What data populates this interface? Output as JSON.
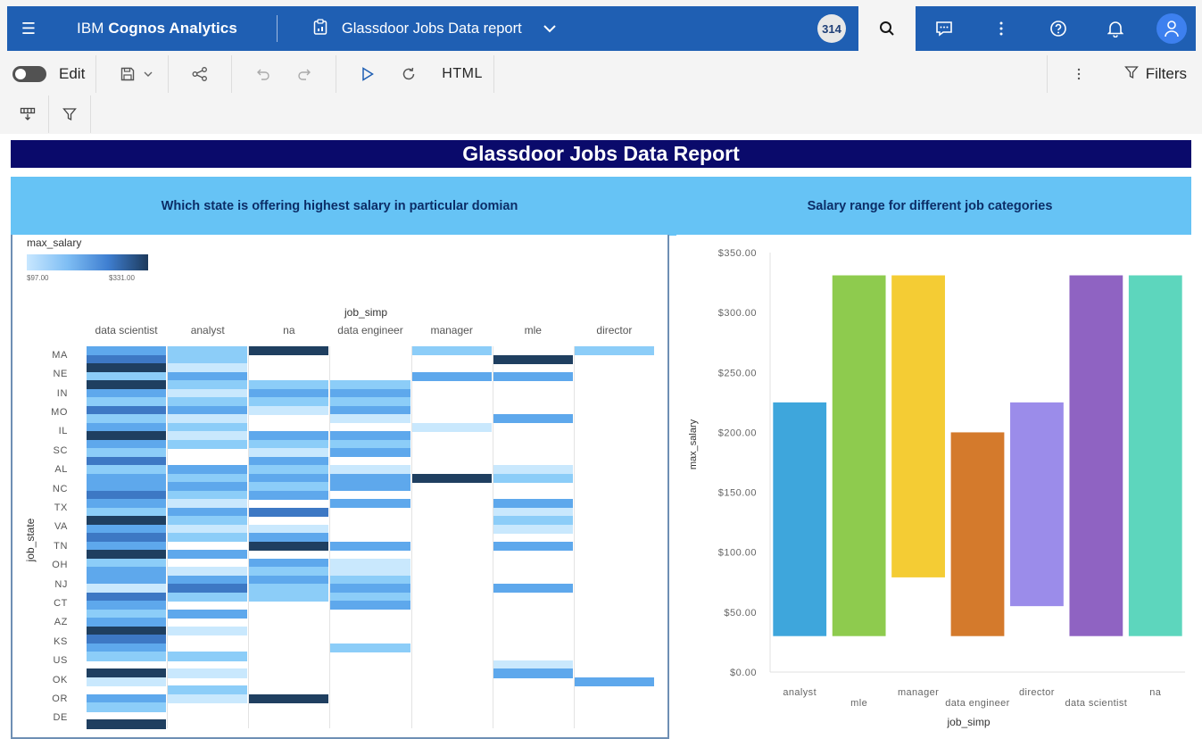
{
  "appbar": {
    "brand_prefix": "IBM",
    "brand_name": "Cognos Analytics",
    "report_title": "Glassdoor Jobs Data report",
    "badge": "314"
  },
  "toolbar": {
    "edit_label": "Edit",
    "html_label": "HTML",
    "filters_label": "Filters"
  },
  "report": {
    "header": "Glassdoor Jobs Data Report",
    "left_panel_title": "Which state is offering highest salary in particular domian",
    "right_panel_title": "Salary range for different job categories"
  },
  "heatmap": {
    "legend_title": "max_salary",
    "legend_min": "$97.00",
    "legend_max": "$331.00",
    "x_title": "job_simp",
    "y_title": "job_state",
    "columns": [
      "data scientist",
      "analyst",
      "na",
      "data engineer",
      "manager",
      "mle",
      "director"
    ],
    "rows": [
      "MA",
      "NE",
      "IN",
      "MO",
      "IL",
      "SC",
      "AL",
      "NC",
      "TX",
      "VA",
      "TN",
      "OH",
      "NJ",
      "CT",
      "AZ",
      "KS",
      "US",
      "OK",
      "OR",
      "DE"
    ],
    "colors": {
      "1": "#c9e8fd",
      "2": "#8ccdf8",
      "3": "#5ea8ec",
      "4": "#3d78c4",
      "5": "#1f3f60"
    },
    "cells": [
      [
        0,
        3,
        0
      ],
      [
        0,
        4,
        1
      ],
      [
        0,
        5,
        2
      ],
      [
        0,
        2,
        3
      ],
      [
        0,
        5,
        4
      ],
      [
        0,
        3,
        5
      ],
      [
        0,
        2,
        6
      ],
      [
        0,
        4,
        7
      ],
      [
        0,
        2,
        8
      ],
      [
        0,
        3,
        9
      ],
      [
        0,
        5,
        10
      ],
      [
        0,
        3,
        11
      ],
      [
        0,
        2,
        12
      ],
      [
        0,
        4,
        13
      ],
      [
        0,
        2,
        14
      ],
      [
        0,
        3,
        15
      ],
      [
        0,
        3,
        16
      ],
      [
        0,
        4,
        17
      ],
      [
        0,
        3,
        18
      ],
      [
        0,
        2,
        19
      ],
      [
        0,
        5,
        20
      ],
      [
        0,
        3,
        21
      ],
      [
        0,
        4,
        22
      ],
      [
        0,
        3,
        23
      ],
      [
        0,
        5,
        24
      ],
      [
        0,
        2,
        25
      ],
      [
        0,
        3,
        26
      ],
      [
        0,
        3,
        27
      ],
      [
        0,
        1,
        28
      ],
      [
        0,
        4,
        29
      ],
      [
        0,
        3,
        30
      ],
      [
        0,
        2,
        31
      ],
      [
        0,
        3,
        32
      ],
      [
        0,
        5,
        33
      ],
      [
        0,
        4,
        34
      ],
      [
        0,
        3,
        35
      ],
      [
        0,
        2,
        36
      ],
      [
        0,
        5,
        38
      ],
      [
        0,
        1,
        39
      ],
      [
        0,
        3,
        41
      ],
      [
        0,
        2,
        42
      ],
      [
        0,
        5,
        44
      ],
      [
        1,
        2,
        0
      ],
      [
        1,
        2,
        1
      ],
      [
        1,
        1,
        2
      ],
      [
        1,
        3,
        3
      ],
      [
        1,
        2,
        4
      ],
      [
        1,
        1,
        5
      ],
      [
        1,
        2,
        6
      ],
      [
        1,
        3,
        7
      ],
      [
        1,
        1,
        8
      ],
      [
        1,
        2,
        9
      ],
      [
        1,
        1,
        10
      ],
      [
        1,
        2,
        11
      ],
      [
        1,
        3,
        14
      ],
      [
        1,
        2,
        15
      ],
      [
        1,
        3,
        16
      ],
      [
        1,
        2,
        17
      ],
      [
        1,
        1,
        18
      ],
      [
        1,
        3,
        19
      ],
      [
        1,
        2,
        20
      ],
      [
        1,
        1,
        21
      ],
      [
        1,
        2,
        22
      ],
      [
        1,
        3,
        24
      ],
      [
        1,
        1,
        26
      ],
      [
        1,
        3,
        27
      ],
      [
        1,
        4,
        28
      ],
      [
        1,
        2,
        29
      ],
      [
        1,
        3,
        31
      ],
      [
        1,
        1,
        33
      ],
      [
        1,
        2,
        36
      ],
      [
        1,
        1,
        38
      ],
      [
        1,
        2,
        40
      ],
      [
        1,
        1,
        41
      ],
      [
        2,
        5,
        0
      ],
      [
        2,
        2,
        4
      ],
      [
        2,
        3,
        5
      ],
      [
        2,
        2,
        6
      ],
      [
        2,
        1,
        7
      ],
      [
        2,
        3,
        10
      ],
      [
        2,
        2,
        11
      ],
      [
        2,
        1,
        12
      ],
      [
        2,
        3,
        13
      ],
      [
        2,
        2,
        14
      ],
      [
        2,
        3,
        15
      ],
      [
        2,
        2,
        16
      ],
      [
        2,
        3,
        17
      ],
      [
        2,
        4,
        19
      ],
      [
        2,
        1,
        21
      ],
      [
        2,
        3,
        22
      ],
      [
        2,
        5,
        23
      ],
      [
        2,
        3,
        25
      ],
      [
        2,
        2,
        26
      ],
      [
        2,
        3,
        27
      ],
      [
        2,
        2,
        28
      ],
      [
        2,
        2,
        29
      ],
      [
        2,
        5,
        41
      ],
      [
        3,
        2,
        4
      ],
      [
        3,
        3,
        5
      ],
      [
        3,
        2,
        6
      ],
      [
        3,
        3,
        7
      ],
      [
        3,
        1,
        8
      ],
      [
        3,
        3,
        10
      ],
      [
        3,
        2,
        11
      ],
      [
        3,
        3,
        12
      ],
      [
        3,
        1,
        14
      ],
      [
        3,
        3,
        15
      ],
      [
        3,
        3,
        16
      ],
      [
        3,
        3,
        18
      ],
      [
        3,
        3,
        23
      ],
      [
        3,
        1,
        25
      ],
      [
        3,
        1,
        26
      ],
      [
        3,
        2,
        27
      ],
      [
        3,
        3,
        28
      ],
      [
        3,
        2,
        29
      ],
      [
        3,
        3,
        30
      ],
      [
        3,
        2,
        35
      ],
      [
        4,
        2,
        0
      ],
      [
        4,
        3,
        3
      ],
      [
        4,
        1,
        9
      ],
      [
        4,
        5,
        15
      ],
      [
        5,
        5,
        1
      ],
      [
        5,
        3,
        3
      ],
      [
        5,
        3,
        8
      ],
      [
        5,
        1,
        14
      ],
      [
        5,
        2,
        15
      ],
      [
        5,
        3,
        18
      ],
      [
        5,
        1,
        19
      ],
      [
        5,
        2,
        20
      ],
      [
        5,
        1,
        21
      ],
      [
        5,
        3,
        23
      ],
      [
        5,
        3,
        28
      ],
      [
        5,
        1,
        37
      ],
      [
        5,
        3,
        38
      ],
      [
        6,
        2,
        0
      ],
      [
        6,
        3,
        39
      ]
    ]
  },
  "chart_data": {
    "type": "bar",
    "subtype": "floating range (min to max)",
    "title": "Salary range for different job categories",
    "xlabel": "job_simp",
    "ylabel": "max_salary",
    "categories": [
      "analyst",
      "mle",
      "manager",
      "data engineer",
      "director",
      "data scientist",
      "na"
    ],
    "ranges": [
      [
        30,
        225
      ],
      [
        30,
        331
      ],
      [
        79,
        331
      ],
      [
        30,
        200
      ],
      [
        55,
        225
      ],
      [
        30,
        331
      ],
      [
        30,
        331
      ]
    ],
    "colors": [
      "#3ea6dc",
      "#8ecb4e",
      "#f4cc34",
      "#d47a2c",
      "#9b8cea",
      "#8f63c2",
      "#5dd6bd"
    ],
    "ylim": [
      0,
      350
    ],
    "yticks": [
      "$0.00",
      "$50.00",
      "$100.00",
      "$150.00",
      "$200.00",
      "$250.00",
      "$300.00",
      "$350.00"
    ],
    "grid": false
  }
}
